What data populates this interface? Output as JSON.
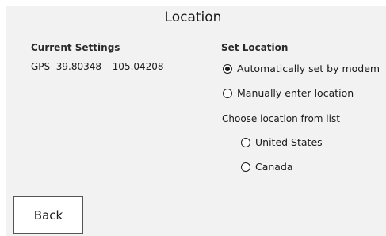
{
  "page": {
    "title": "Location"
  },
  "current_settings": {
    "heading": "Current Settings",
    "gps_text": "GPS  39.80348  –105.04208"
  },
  "set_location": {
    "heading": "Set Location",
    "selected": "auto",
    "options": [
      {
        "id": "auto",
        "label": "Automatically set by modem",
        "checked": true
      },
      {
        "id": "manual",
        "label": "Manually enter location",
        "checked": false
      }
    ],
    "list_label": "Choose location from list",
    "list_options": [
      {
        "id": "us",
        "label": "United States",
        "checked": false
      },
      {
        "id": "ca",
        "label": "Canada",
        "checked": false
      }
    ]
  },
  "buttons": {
    "back_label": "Back"
  },
  "colors": {
    "panel_background": "#f2f2f2",
    "page_background": "#ffffff",
    "text": "#1a1a1a"
  }
}
